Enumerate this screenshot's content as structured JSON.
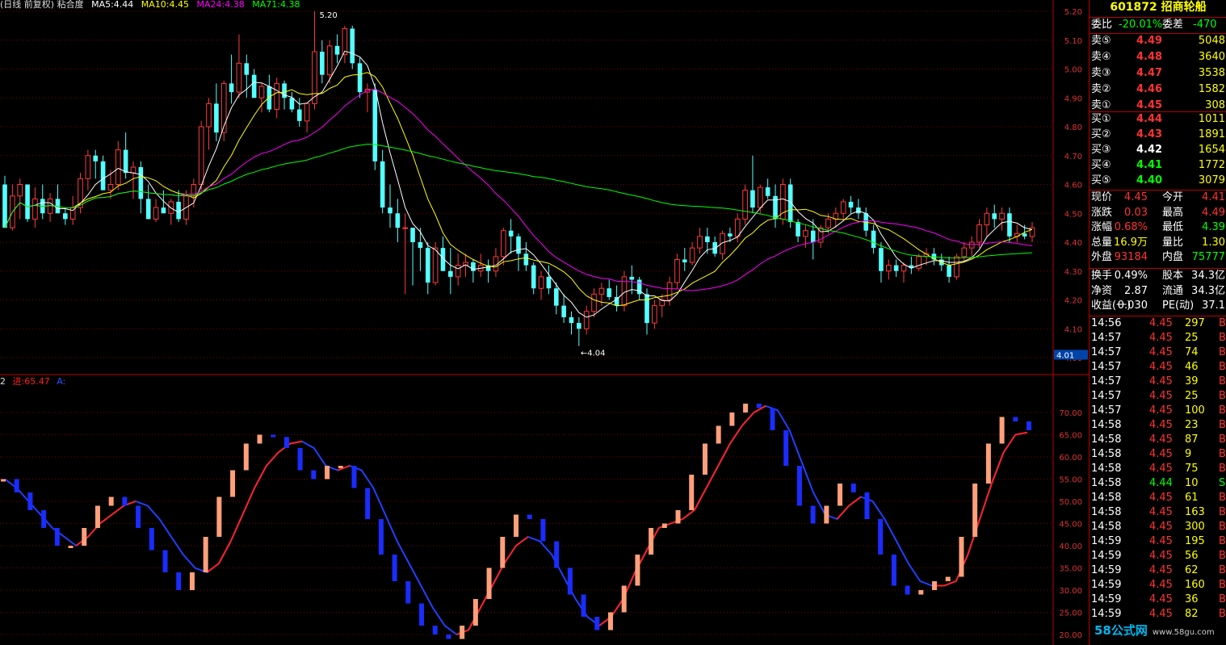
{
  "chart_data": [
    {
      "type": "candlestick",
      "title": "(日线 前复权) 粘合度",
      "legend": [
        {
          "label": "MA5:4.44",
          "color": "#ffffff"
        },
        {
          "label": "MA10:4.45",
          "color": "#ffff00"
        },
        {
          "label": "MA24:4.38",
          "color": "#ff00ff"
        },
        {
          "label": "MA71:4.38",
          "color": "#00ff00"
        }
      ],
      "ylim": [
        4.0,
        5.2
      ],
      "yticks": [
        "5.20",
        "5.10",
        "5.00",
        "4.90",
        "4.80",
        "4.70",
        "4.60",
        "4.50",
        "4.40",
        "4.30",
        "4.20",
        "4.10",
        "4.00"
      ],
      "current_price_label": "4.01",
      "annotations": [
        {
          "text": "5.20",
          "type": "high"
        },
        {
          "text": "←4.04",
          "type": "low"
        }
      ],
      "candles": [
        [
          4.6,
          4.63,
          4.45,
          4.45
        ],
        [
          4.45,
          4.6,
          4.44,
          4.56
        ],
        [
          4.56,
          4.62,
          4.48,
          4.6
        ],
        [
          4.6,
          4.6,
          4.47,
          4.48
        ],
        [
          4.48,
          4.59,
          4.45,
          4.55
        ],
        [
          4.55,
          4.6,
          4.48,
          4.5
        ],
        [
          4.5,
          4.57,
          4.47,
          4.55
        ],
        [
          4.55,
          4.6,
          4.5,
          4.5
        ],
        [
          4.5,
          4.52,
          4.46,
          4.48
        ],
        [
          4.48,
          4.56,
          4.46,
          4.52
        ],
        [
          4.52,
          4.64,
          4.5,
          4.62
        ],
        [
          4.62,
          4.72,
          4.58,
          4.7
        ],
        [
          4.7,
          4.72,
          4.62,
          4.68
        ],
        [
          4.68,
          4.7,
          4.58,
          4.58
        ],
        [
          4.58,
          4.65,
          4.55,
          4.6
        ],
        [
          4.6,
          4.75,
          4.58,
          4.72
        ],
        [
          4.72,
          4.78,
          4.62,
          4.64
        ],
        [
          4.64,
          4.68,
          4.55,
          4.66
        ],
        [
          4.66,
          4.68,
          4.5,
          4.55
        ],
        [
          4.55,
          4.6,
          4.48,
          4.48
        ],
        [
          4.48,
          4.55,
          4.47,
          4.52
        ],
        [
          4.52,
          4.58,
          4.5,
          4.5
        ],
        [
          4.5,
          4.55,
          4.46,
          4.54
        ],
        [
          4.54,
          4.58,
          4.47,
          4.48
        ],
        [
          4.48,
          4.58,
          4.46,
          4.56
        ],
        [
          4.56,
          4.62,
          4.52,
          4.6
        ],
        [
          4.6,
          4.82,
          4.58,
          4.8
        ],
        [
          4.8,
          4.9,
          4.72,
          4.88
        ],
        [
          4.88,
          4.95,
          4.75,
          4.78
        ],
        [
          4.78,
          4.96,
          4.75,
          4.95
        ],
        [
          4.95,
          5.05,
          4.88,
          4.92
        ],
        [
          4.92,
          5.12,
          4.9,
          5.02
        ],
        [
          5.02,
          5.05,
          4.9,
          4.98
        ],
        [
          4.98,
          5.0,
          4.9,
          4.9
        ],
        [
          4.9,
          4.95,
          4.85,
          4.94
        ],
        [
          4.94,
          4.98,
          4.85,
          4.86
        ],
        [
          4.86,
          4.97,
          4.83,
          4.95
        ],
        [
          4.95,
          4.96,
          4.86,
          4.9
        ],
        [
          4.9,
          4.92,
          4.85,
          4.86
        ],
        [
          4.86,
          4.9,
          4.8,
          4.82
        ],
        [
          4.82,
          4.88,
          4.78,
          4.88
        ],
        [
          4.88,
          5.2,
          4.86,
          5.06
        ],
        [
          5.06,
          5.1,
          4.95,
          4.98
        ],
        [
          4.98,
          5.1,
          4.95,
          5.08
        ],
        [
          5.08,
          5.12,
          5.02,
          5.05
        ],
        [
          5.05,
          5.15,
          5.02,
          5.14
        ],
        [
          5.14,
          5.15,
          5.0,
          5.02
        ],
        [
          5.02,
          5.04,
          4.9,
          4.92
        ],
        [
          4.92,
          4.95,
          4.85,
          4.93
        ],
        [
          4.93,
          4.95,
          4.65,
          4.68
        ],
        [
          4.68,
          4.72,
          4.5,
          4.52
        ],
        [
          4.52,
          4.6,
          4.45,
          4.5
        ],
        [
          4.5,
          4.55,
          4.4,
          4.45
        ],
        [
          4.45,
          4.5,
          4.22,
          4.45
        ],
        [
          4.45,
          4.45,
          4.25,
          4.4
        ],
        [
          4.4,
          4.45,
          4.3,
          4.38
        ],
        [
          4.38,
          4.4,
          4.22,
          4.26
        ],
        [
          4.26,
          4.4,
          4.25,
          4.38
        ],
        [
          4.38,
          4.42,
          4.3,
          4.3
        ],
        [
          4.3,
          4.38,
          4.22,
          4.28
        ],
        [
          4.28,
          4.36,
          4.25,
          4.32
        ],
        [
          4.32,
          4.36,
          4.28,
          4.33
        ],
        [
          4.33,
          4.34,
          4.26,
          4.3
        ],
        [
          4.3,
          4.36,
          4.28,
          4.32
        ],
        [
          4.32,
          4.34,
          4.26,
          4.3
        ],
        [
          4.3,
          4.38,
          4.28,
          4.35
        ],
        [
          4.35,
          4.45,
          4.32,
          4.44
        ],
        [
          4.44,
          4.48,
          4.36,
          4.42
        ],
        [
          4.42,
          4.43,
          4.3,
          4.36
        ],
        [
          4.36,
          4.4,
          4.3,
          4.32
        ],
        [
          4.32,
          4.33,
          4.22,
          4.24
        ],
        [
          4.24,
          4.3,
          4.2,
          4.28
        ],
        [
          4.28,
          4.32,
          4.22,
          4.24
        ],
        [
          4.24,
          4.26,
          4.15,
          4.18
        ],
        [
          4.18,
          4.22,
          4.12,
          4.14
        ],
        [
          4.14,
          4.16,
          4.08,
          4.12
        ],
        [
          4.12,
          4.14,
          4.04,
          4.1
        ],
        [
          4.1,
          4.18,
          4.08,
          4.16
        ],
        [
          4.16,
          4.24,
          4.14,
          4.22
        ],
        [
          4.22,
          4.26,
          4.18,
          4.24
        ],
        [
          4.24,
          4.27,
          4.2,
          4.21
        ],
        [
          4.21,
          4.25,
          4.16,
          4.18
        ],
        [
          4.18,
          4.3,
          4.16,
          4.28
        ],
        [
          4.28,
          4.32,
          4.22,
          4.27
        ],
        [
          4.27,
          4.28,
          4.2,
          4.22
        ],
        [
          4.22,
          4.24,
          4.08,
          4.12
        ],
        [
          4.12,
          4.2,
          4.1,
          4.18
        ],
        [
          4.18,
          4.22,
          4.14,
          4.2
        ],
        [
          4.2,
          4.28,
          4.18,
          4.26
        ],
        [
          4.26,
          4.36,
          4.24,
          4.34
        ],
        [
          4.34,
          4.38,
          4.3,
          4.33
        ],
        [
          4.33,
          4.4,
          4.32,
          4.38
        ],
        [
          4.38,
          4.45,
          4.36,
          4.42
        ],
        [
          4.42,
          4.45,
          4.36,
          4.4
        ],
        [
          4.4,
          4.42,
          4.35,
          4.36
        ],
        [
          4.36,
          4.44,
          4.34,
          4.43
        ],
        [
          4.43,
          4.45,
          4.4,
          4.42
        ],
        [
          4.42,
          4.5,
          4.4,
          4.48
        ],
        [
          4.48,
          4.6,
          4.46,
          4.58
        ],
        [
          4.58,
          4.7,
          4.5,
          4.52
        ],
        [
          4.52,
          4.6,
          4.5,
          4.59
        ],
        [
          4.59,
          4.62,
          4.55,
          4.56
        ],
        [
          4.56,
          4.6,
          4.45,
          4.48
        ],
        [
          4.48,
          4.62,
          4.46,
          4.6
        ],
        [
          4.6,
          4.62,
          4.45,
          4.47
        ],
        [
          4.47,
          4.48,
          4.4,
          4.42
        ],
        [
          4.42,
          4.46,
          4.38,
          4.44
        ],
        [
          4.44,
          4.48,
          4.34,
          4.4
        ],
        [
          4.4,
          4.46,
          4.38,
          4.45
        ],
        [
          4.45,
          4.5,
          4.43,
          4.48
        ],
        [
          4.48,
          4.52,
          4.45,
          4.5
        ],
        [
          4.5,
          4.55,
          4.48,
          4.54
        ],
        [
          4.54,
          4.56,
          4.5,
          4.52
        ],
        [
          4.52,
          4.55,
          4.48,
          4.5
        ],
        [
          4.5,
          4.52,
          4.42,
          4.44
        ],
        [
          4.44,
          4.46,
          4.36,
          4.38
        ],
        [
          4.38,
          4.4,
          4.26,
          4.3
        ],
        [
          4.3,
          4.34,
          4.27,
          4.32
        ],
        [
          4.32,
          4.34,
          4.28,
          4.3
        ],
        [
          4.3,
          4.33,
          4.26,
          4.32
        ],
        [
          4.32,
          4.35,
          4.29,
          4.31
        ],
        [
          4.31,
          4.36,
          4.3,
          4.35
        ],
        [
          4.35,
          4.38,
          4.32,
          4.36
        ],
        [
          4.36,
          4.38,
          4.32,
          4.34
        ],
        [
          4.34,
          4.36,
          4.3,
          4.32
        ],
        [
          4.32,
          4.35,
          4.26,
          4.28
        ],
        [
          4.28,
          4.36,
          4.27,
          4.35
        ],
        [
          4.35,
          4.4,
          4.33,
          4.38
        ],
        [
          4.38,
          4.42,
          4.35,
          4.4
        ],
        [
          4.4,
          4.48,
          4.38,
          4.46
        ],
        [
          4.46,
          4.52,
          4.42,
          4.5
        ],
        [
          4.5,
          4.53,
          4.45,
          4.48
        ],
        [
          4.48,
          4.52,
          4.44,
          4.5
        ],
        [
          4.5,
          4.52,
          4.4,
          4.42
        ],
        [
          4.42,
          4.46,
          4.4,
          4.43
        ],
        [
          4.43,
          4.46,
          4.41,
          4.42
        ],
        [
          4.42,
          4.47,
          4.4,
          4.45
        ]
      ]
    },
    {
      "type": "line",
      "title": "粘合度",
      "legend": [
        {
          "label": "2",
          "color": "#dddddd"
        },
        {
          "label": "进:65.47",
          "color": "#ff2020"
        },
        {
          "label": "A:",
          "color": "#3050ff"
        }
      ],
      "ylim": [
        18,
        76
      ],
      "yticks": [
        "70.00",
        "65.00",
        "60.00",
        "55.00",
        "50.00",
        "45.00",
        "40.00",
        "35.00",
        "30.00",
        "25.00",
        "20.00"
      ],
      "series": [
        {
          "name": "进",
          "values": [
            55,
            53,
            50,
            47,
            44,
            42,
            40,
            42,
            45,
            47,
            49,
            50,
            49,
            46,
            42,
            38,
            35,
            34,
            36,
            41,
            47,
            53,
            58,
            61,
            63,
            63.5,
            62,
            58,
            57,
            58,
            57,
            53,
            47,
            41,
            36,
            31,
            26,
            22,
            20,
            21,
            26,
            31,
            36,
            40,
            42,
            41,
            38,
            33,
            28,
            24,
            22,
            24,
            28,
            34,
            39,
            44,
            45,
            46,
            48,
            53,
            58,
            63,
            67,
            70,
            71.5,
            70.5,
            66,
            59,
            52,
            47,
            46,
            49,
            51,
            50,
            46,
            41,
            36,
            32,
            31,
            31,
            32,
            38,
            46,
            54,
            61,
            65,
            65.5
          ]
        },
        {
          "name": "A",
          "values": [
            55,
            52,
            48,
            44,
            40,
            40,
            44,
            49,
            51,
            49,
            44,
            39,
            34,
            30,
            34,
            42,
            51,
            57,
            63,
            65,
            64.5,
            62,
            57,
            55,
            58,
            58,
            53,
            46,
            38,
            32,
            27,
            22,
            20,
            19,
            22,
            28,
            35,
            42,
            47,
            46,
            41,
            35,
            29,
            24,
            21,
            25,
            31,
            38,
            44,
            45,
            48,
            56,
            63,
            67,
            70,
            72,
            71,
            66,
            58,
            49,
            45,
            49,
            54,
            52,
            46,
            38,
            31,
            29,
            30,
            32,
            33,
            42,
            54,
            63,
            69,
            68,
            66
          ]
        }
      ]
    }
  ],
  "quote_panel": {
    "code": "601872",
    "name": "招商轮船",
    "weibi_label": "委比",
    "weibi_value": "-20.01%",
    "weicha_label": "委差",
    "weicha_value": "-470",
    "asks": [
      {
        "label": "卖⑤",
        "price": "4.49",
        "volume": "5048"
      },
      {
        "label": "卖④",
        "price": "4.48",
        "volume": "3640"
      },
      {
        "label": "卖③",
        "price": "4.47",
        "volume": "3538"
      },
      {
        "label": "卖②",
        "price": "4.46",
        "volume": "1582"
      },
      {
        "label": "卖①",
        "price": "4.45",
        "volume": "308"
      }
    ],
    "bids": [
      {
        "label": "买①",
        "price": "4.44",
        "volume": "1011"
      },
      {
        "label": "买②",
        "price": "4.43",
        "volume": "1891"
      },
      {
        "label": "买③",
        "price": "4.42",
        "volume": "1654"
      },
      {
        "label": "买④",
        "price": "4.41",
        "volume": "1772"
      },
      {
        "label": "买⑤",
        "price": "4.40",
        "volume": "3079"
      }
    ],
    "stats": [
      {
        "l1": "现价",
        "v1": "4.45",
        "l2": "今开",
        "v2": "4.41"
      },
      {
        "l1": "涨跌",
        "v1": "0.03",
        "l2": "最高",
        "v2": "4.49"
      },
      {
        "l1": "涨幅",
        "v1": "0.68%",
        "l2": "最低",
        "v2": "4.39"
      },
      {
        "l1": "总量",
        "v1": "16.9万",
        "l2": "量比",
        "v2": "1.30"
      },
      {
        "l1": "外盘",
        "v1": "93184",
        "l2": "内盘",
        "v2": "75777"
      }
    ],
    "fund": [
      {
        "l1": "换手",
        "v1": "0.49%",
        "l2": "股本",
        "v2": "34.3亿"
      },
      {
        "l1": "净资",
        "v1": "2.87",
        "l2": "流通",
        "v2": "34.3亿"
      },
      {
        "l1": "收益(一)",
        "v1": "0.030",
        "l2": "PE(动)",
        "v2": "37.1"
      }
    ],
    "ticks": [
      [
        "14:56",
        "4.45",
        "297",
        "B"
      ],
      [
        "14:57",
        "4.45",
        "25",
        "B"
      ],
      [
        "14:57",
        "4.45",
        "74",
        "B"
      ],
      [
        "14:57",
        "4.45",
        "46",
        "B"
      ],
      [
        "14:57",
        "4.45",
        "39",
        "B"
      ],
      [
        "14:57",
        "4.45",
        "25",
        "B"
      ],
      [
        "14:57",
        "4.45",
        "100",
        "B"
      ],
      [
        "14:58",
        "4.45",
        "23",
        "B"
      ],
      [
        "14:58",
        "4.45",
        "87",
        "B"
      ],
      [
        "14:58",
        "4.45",
        "9",
        "B"
      ],
      [
        "14:58",
        "4.45",
        "75",
        "B"
      ],
      [
        "14:58",
        "4.44",
        "10",
        "S"
      ],
      [
        "14:58",
        "4.45",
        "61",
        "B"
      ],
      [
        "14:58",
        "4.45",
        "163",
        "B"
      ],
      [
        "14:58",
        "4.45",
        "300",
        "B"
      ],
      [
        "14:59",
        "4.45",
        "195",
        "B"
      ],
      [
        "14:59",
        "4.45",
        "56",
        "B"
      ],
      [
        "14:59",
        "4.45",
        "62",
        "B"
      ],
      [
        "14:59",
        "4.45",
        "160",
        "B"
      ],
      [
        "14:59",
        "4.45",
        "36",
        "B"
      ],
      [
        "14:59",
        "4.45",
        "82",
        "B"
      ]
    ],
    "colors": {
      "up": "#ff3333",
      "down": "#00ff00",
      "neutral": "#ffffff",
      "label": "#ffffff",
      "yellow": "#ffff00",
      "cyan": "#00ffff"
    }
  },
  "watermark": {
    "text": "58公式网",
    "url": "www.58gu.com"
  }
}
